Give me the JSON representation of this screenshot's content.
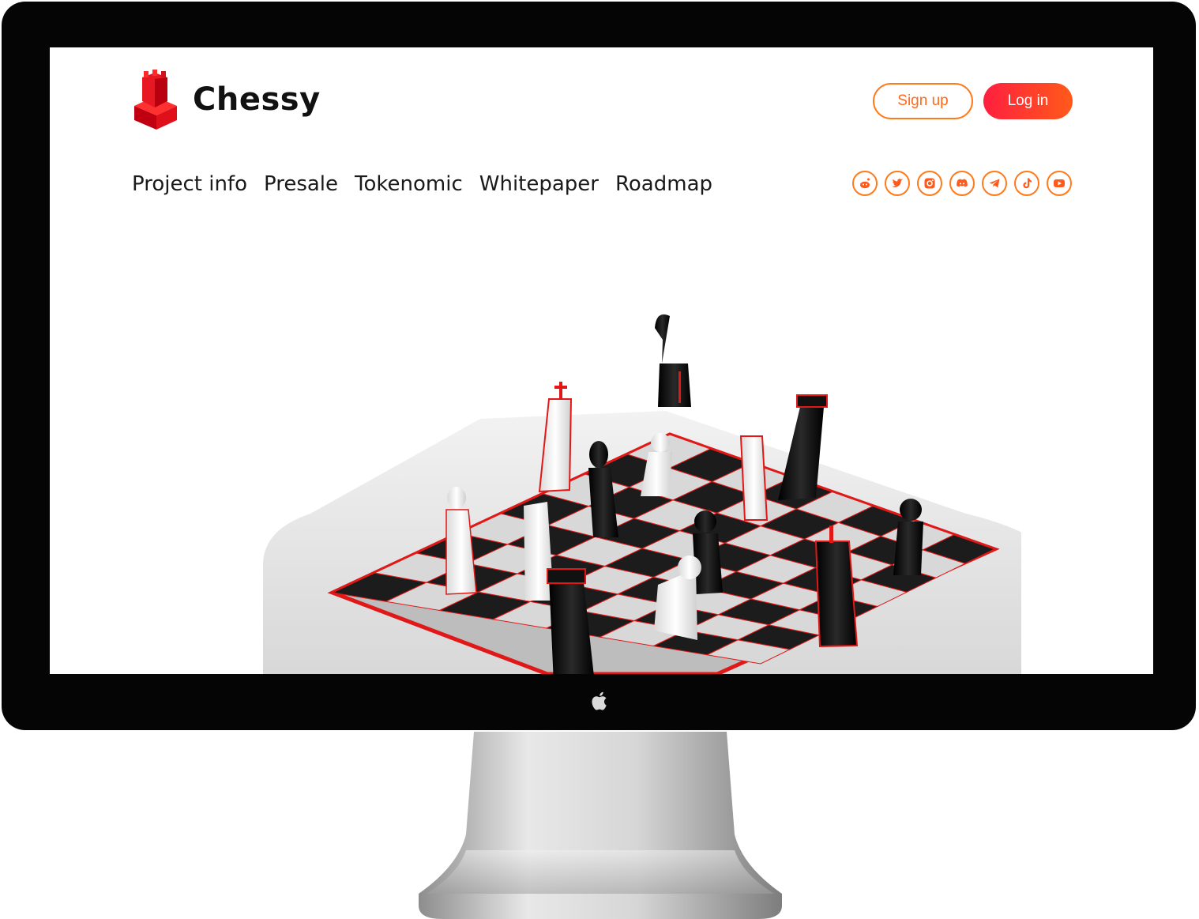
{
  "header": {
    "brand": "Chessy",
    "signup_label": "Sign up",
    "login_label": "Log in"
  },
  "nav": {
    "items": [
      "Project info",
      "Presale",
      "Tokenomic",
      "Whitepaper",
      "Roadmap"
    ]
  },
  "socials": {
    "icons": [
      "reddit-icon",
      "twitter-icon",
      "instagram-icon",
      "discord-icon",
      "telegram-icon",
      "tiktok-icon",
      "youtube-icon"
    ]
  },
  "colors": {
    "accent": "#ff6a1a",
    "accent_red": "#ff1f3f",
    "logo_red": "#e0101a"
  }
}
